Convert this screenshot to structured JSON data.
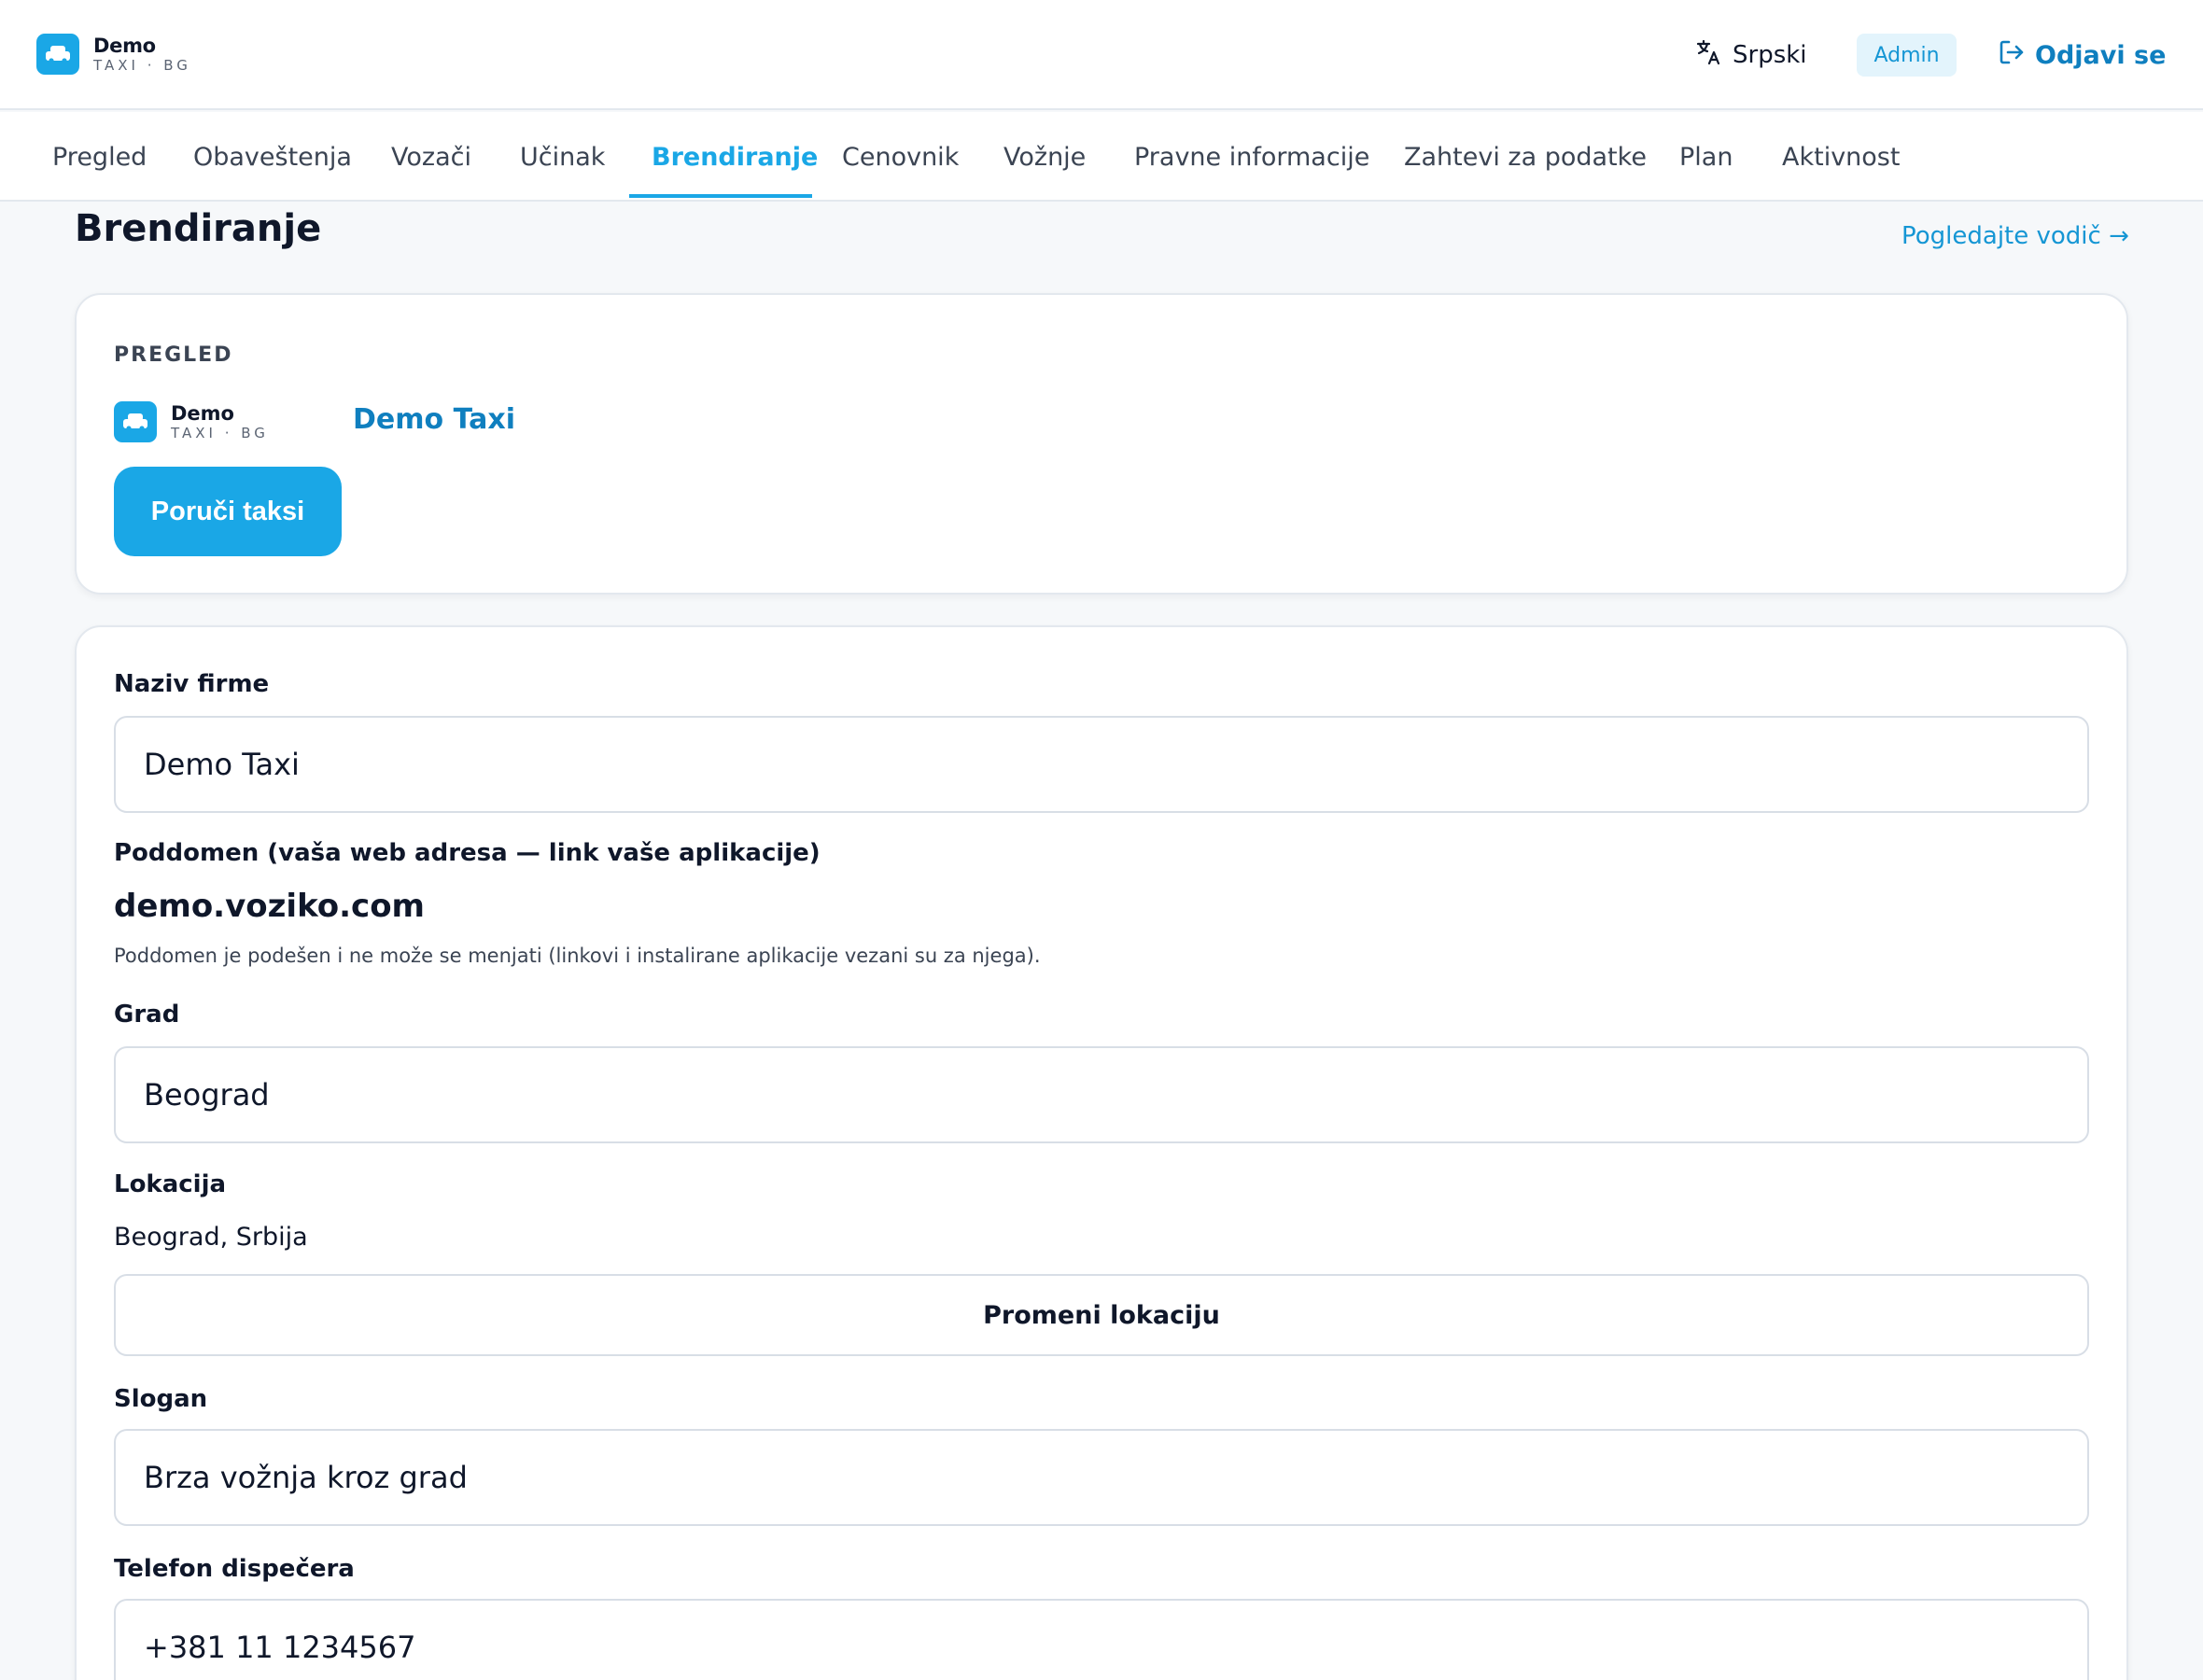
{
  "brand": {
    "name": "Demo",
    "sub": "TAXI · BG",
    "accent": "#1aa7e6"
  },
  "header": {
    "language": "Srpski",
    "role_badge": "Admin",
    "logout_label": "Odjavi se"
  },
  "tabs": [
    {
      "label": "Pregled",
      "active": false
    },
    {
      "label": "Obaveštenja",
      "active": false
    },
    {
      "label": "Vozači",
      "active": false
    },
    {
      "label": "Učinak",
      "active": false
    },
    {
      "label": "Brendiranje",
      "active": true
    },
    {
      "label": "Cenovnik",
      "active": false
    },
    {
      "label": "Vožnje",
      "active": false
    },
    {
      "label": "Pravne informacije",
      "active": false
    },
    {
      "label": "Zahtevi za podatke",
      "active": false
    },
    {
      "label": "Plan",
      "active": false
    },
    {
      "label": "Aktivnost",
      "active": false
    }
  ],
  "page": {
    "title": "Brendiranje",
    "guide_link": "Pogledajte vodič →"
  },
  "preview": {
    "section_label": "PREGLED",
    "logo_name": "Demo",
    "logo_sub": "TAXI · BG",
    "brand_name": "Demo Taxi",
    "order_button": "Poruči taksi"
  },
  "form": {
    "company_name": {
      "label": "Naziv firme",
      "value": "Demo Taxi"
    },
    "subdomain": {
      "label": "Poddomen (vaša web adresa — link vaše aplikacije)",
      "value": "demo.voziko.com",
      "hint": "Poddomen je podešen i ne može se menjati (linkovi i instalirane aplikacije vezani su za njega)."
    },
    "city": {
      "label": "Grad",
      "value": "Beograd"
    },
    "location": {
      "label": "Lokacija",
      "value": "Beograd, Srbija",
      "change_button": "Promeni lokaciju"
    },
    "slogan": {
      "label": "Slogan",
      "value": "Brza vožnja kroz grad"
    },
    "dispatcher_phone": {
      "label": "Telefon dispečera",
      "value": "+381 11 1234567"
    }
  }
}
